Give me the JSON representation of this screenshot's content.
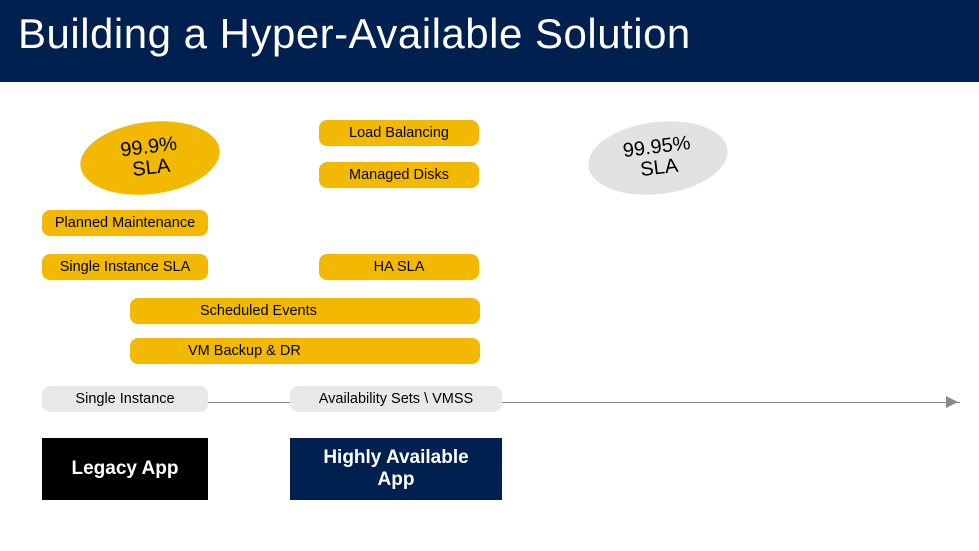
{
  "header": {
    "title": "Building a Hyper-Available Solution"
  },
  "sla_left": "99.9%\nSLA",
  "sla_right": "99.95%\nSLA",
  "pills": {
    "load_balancing": "Load Balancing",
    "managed_disks": "Managed Disks",
    "planned_maintenance": "Planned Maintenance",
    "single_instance_sla": "Single Instance SLA",
    "ha_sla": "HA SLA",
    "scheduled_events": "Scheduled Events",
    "vm_backup_dr": "VM Backup & DR",
    "single_instance": "Single Instance",
    "availability_sets": "Availability Sets \\ VMSS"
  },
  "labels": {
    "legacy_app": "Legacy App",
    "highly_available_app": "Highly Available\nApp"
  }
}
